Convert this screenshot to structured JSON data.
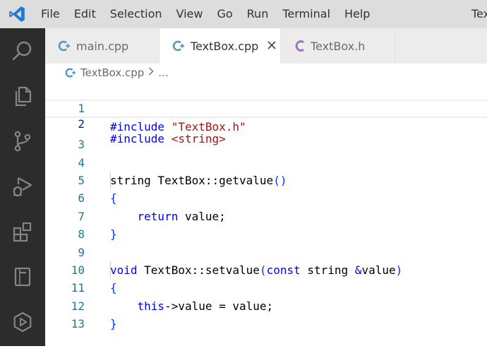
{
  "menu": [
    "File",
    "Edit",
    "Selection",
    "View",
    "Go",
    "Run",
    "Terminal",
    "Help"
  ],
  "window_title": "Tex",
  "tabs": [
    {
      "label": "main.cpp",
      "icon": "cpp-file-icon",
      "active": false
    },
    {
      "label": "TextBox.cpp",
      "icon": "cpp-file-icon",
      "active": true
    },
    {
      "label": "TextBox.h",
      "icon": "c-header-file-icon",
      "active": false
    }
  ],
  "breadcrumb": {
    "file": "TextBox.cpp",
    "more": "..."
  },
  "editor": {
    "current_line": 2,
    "lines": [
      {
        "n": "1"
      },
      {
        "n": "2"
      },
      {
        "n": "3"
      },
      {
        "n": "4"
      },
      {
        "n": "5"
      },
      {
        "n": "6"
      },
      {
        "n": "7"
      },
      {
        "n": "8"
      },
      {
        "n": "9"
      },
      {
        "n": "10"
      },
      {
        "n": "11"
      },
      {
        "n": "12"
      },
      {
        "n": "13"
      }
    ],
    "tokens": {
      "l1": [
        "#include",
        " ",
        "\"TextBox.h\""
      ],
      "l2": [
        "#include",
        " ",
        "<string>"
      ],
      "l4": [
        "string TextBox::getvalue",
        "()"
      ],
      "l5": [
        "{"
      ],
      "l6": [
        "    ",
        "return",
        " value;"
      ],
      "l7": [
        "}"
      ],
      "l9": [
        "void",
        " TextBox::setvalue",
        "(",
        "const",
        " string ",
        "&",
        "value",
        ")"
      ],
      "l10": [
        "{"
      ],
      "l11": [
        "    ",
        "this",
        "->value = value;"
      ],
      "l12": [
        "}"
      ]
    }
  },
  "colors": {
    "keyword": "#0000ff",
    "string": "#a31515",
    "line_number": "#237893",
    "activity_bar": "#2c2c2c",
    "vscode_blue": "#1e7ad4",
    "cpp_icon": "#519aba",
    "header_icon": "#a074c4"
  }
}
